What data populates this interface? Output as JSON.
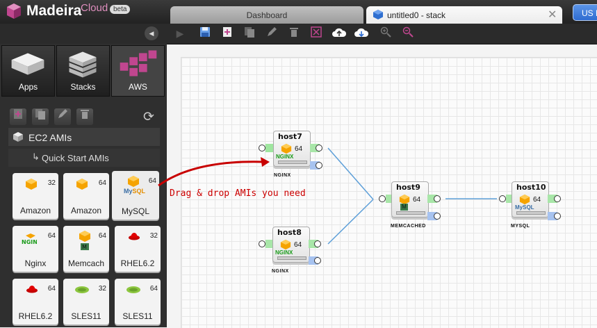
{
  "app": {
    "brand": "Madeira",
    "brand_suffix": "Cloud",
    "badge": "beta"
  },
  "tabs": [
    {
      "label": "Dashboard"
    },
    {
      "label": "untitled0 - stack"
    }
  ],
  "region_button": "US E",
  "sidebar": {
    "categories": [
      {
        "label": "Apps"
      },
      {
        "label": "Stacks"
      },
      {
        "label": "AWS"
      }
    ],
    "section_title": "EC2 AMIs",
    "subsection_title": "Quick Start AMIs",
    "amis": [
      {
        "label": "Amazon",
        "bits": "32",
        "icon": "amazon-box-icon"
      },
      {
        "label": "Amazon",
        "bits": "64",
        "icon": "amazon-box-icon"
      },
      {
        "label": "MySQL",
        "bits": "64",
        "icon": "mysql-icon"
      },
      {
        "label": "Nginx",
        "bits": "64",
        "icon": "nginx-icon"
      },
      {
        "label": "Memcach",
        "bits": "64",
        "icon": "memcached-icon"
      },
      {
        "label": "RHEL6.2",
        "bits": "32",
        "icon": "redhat-icon"
      },
      {
        "label": "RHEL6.2",
        "bits": "64",
        "icon": "redhat-icon"
      },
      {
        "label": "SLES11",
        "bits": "32",
        "icon": "suse-icon"
      },
      {
        "label": "SLES11",
        "bits": "64",
        "icon": "suse-icon"
      }
    ]
  },
  "canvas": {
    "annotation": "Drag & drop AMIs you need",
    "hosts": [
      {
        "name": "host7",
        "bits": "64",
        "tag": "NGINX",
        "app": "NGINX"
      },
      {
        "name": "host8",
        "bits": "64",
        "tag": "NGINX",
        "app": "NGINX"
      },
      {
        "name": "host9",
        "bits": "64",
        "tag": "MEMCACHED",
        "app": "M"
      },
      {
        "name": "host10",
        "bits": "64",
        "tag": "MYSQL",
        "app": "MySQL"
      }
    ]
  },
  "colors": {
    "accent_pink": "#c0468f",
    "port_green": "#a8e6a8",
    "port_blue": "#a7c3f0",
    "annotation_red": "#cc0000",
    "region_button": "#2e6bd0"
  }
}
